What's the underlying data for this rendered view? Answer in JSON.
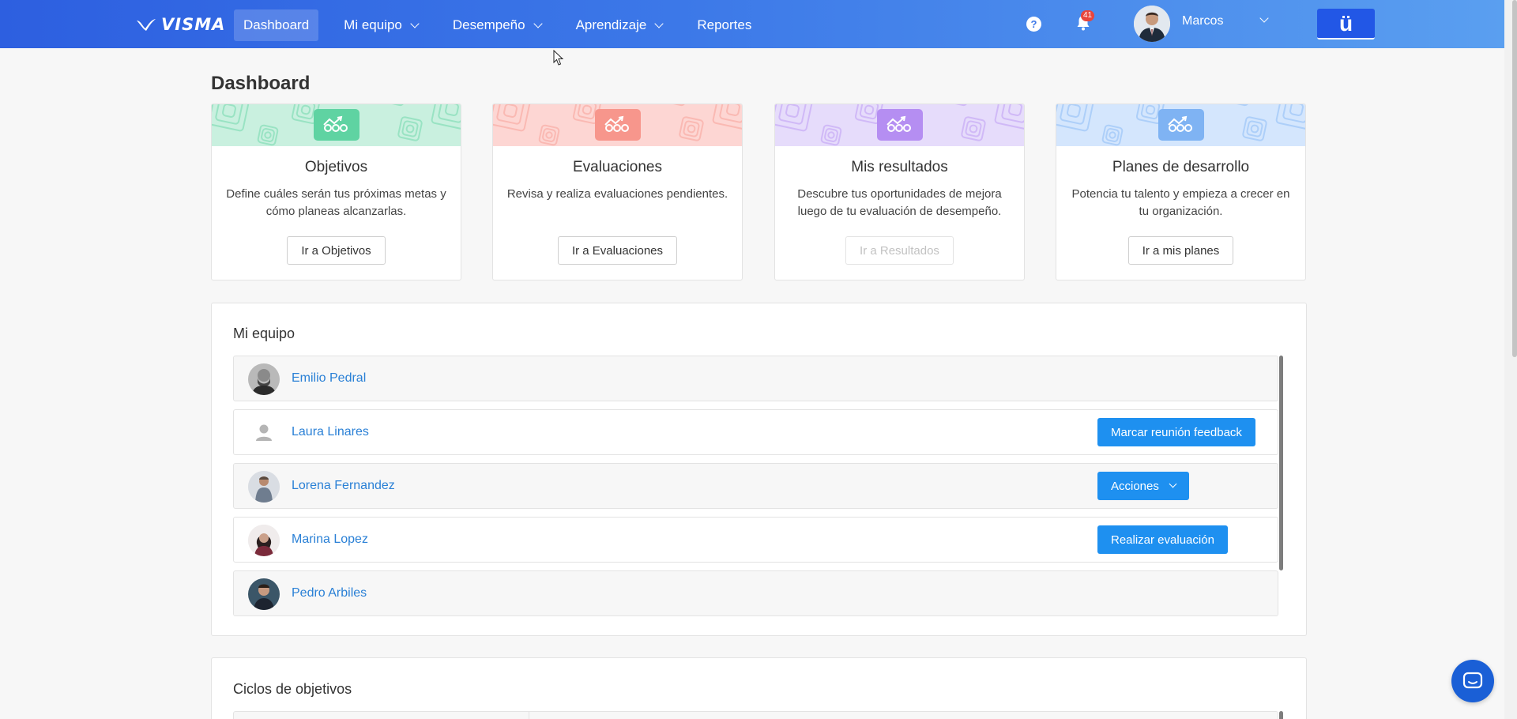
{
  "header": {
    "logo_text": "VISMA",
    "nav": [
      {
        "label": "Dashboard",
        "active": true,
        "dropdown": false
      },
      {
        "label": "Mi equipo",
        "active": false,
        "dropdown": true
      },
      {
        "label": "Desempeño",
        "active": false,
        "dropdown": true
      },
      {
        "label": "Aprendizaje",
        "active": false,
        "dropdown": true
      },
      {
        "label": "Reportes",
        "active": false,
        "dropdown": false
      }
    ],
    "help_icon": "question-circle-icon",
    "notifications": {
      "icon": "bell-icon",
      "count": "41"
    },
    "user": {
      "name": "Marcos",
      "icon": "chevron-down-icon"
    },
    "brand_button": "ü"
  },
  "page": {
    "title": "Dashboard"
  },
  "cards": [
    {
      "title": "Objetivos",
      "description": "Define cuáles serán tus próximas metas y cómo planeas alcanzarlas.",
      "button": "Ir a Objetivos",
      "disabled": false,
      "color": "#c9f0df",
      "accent": "#5fd3a2"
    },
    {
      "title": "Evaluaciones",
      "description": "Revisa y realiza evaluaciones pendientes.",
      "button": "Ir a Evaluaciones",
      "disabled": false,
      "color": "#fdd6d3",
      "accent": "#f7968c"
    },
    {
      "title": "Mis resultados",
      "description": "Descubre tus oportunidades de mejora luego de tu evaluación de desempeño.",
      "button": "Ir a Resultados",
      "disabled": true,
      "color": "#e6dcfb",
      "accent": "#b58ef2"
    },
    {
      "title": "Planes de desarrollo",
      "description": "Potencia tu talento y empieza a crecer en tu organización.",
      "button": "Ir a mis planes",
      "disabled": false,
      "color": "#d4e6fd",
      "accent": "#7fb3f3"
    }
  ],
  "team": {
    "title": "Mi equipo",
    "members": [
      {
        "name": "Emilio Pedral",
        "action": ""
      },
      {
        "name": "Laura Linares",
        "action": "Marcar reunión feedback"
      },
      {
        "name": "Lorena Fernandez",
        "action": "Acciones"
      },
      {
        "name": "Marina Lopez",
        "action": "Realizar evaluación"
      },
      {
        "name": "Pedro Arbiles",
        "action": ""
      }
    ]
  },
  "cycles": {
    "title": "Ciclos de objetivos"
  },
  "colors": {
    "primary": "#1e90f0",
    "link": "#2a80d6",
    "header_start": "#2d5fe0",
    "header_end": "#5a9ff0"
  },
  "chat_icon": "chat-bubble-icon"
}
